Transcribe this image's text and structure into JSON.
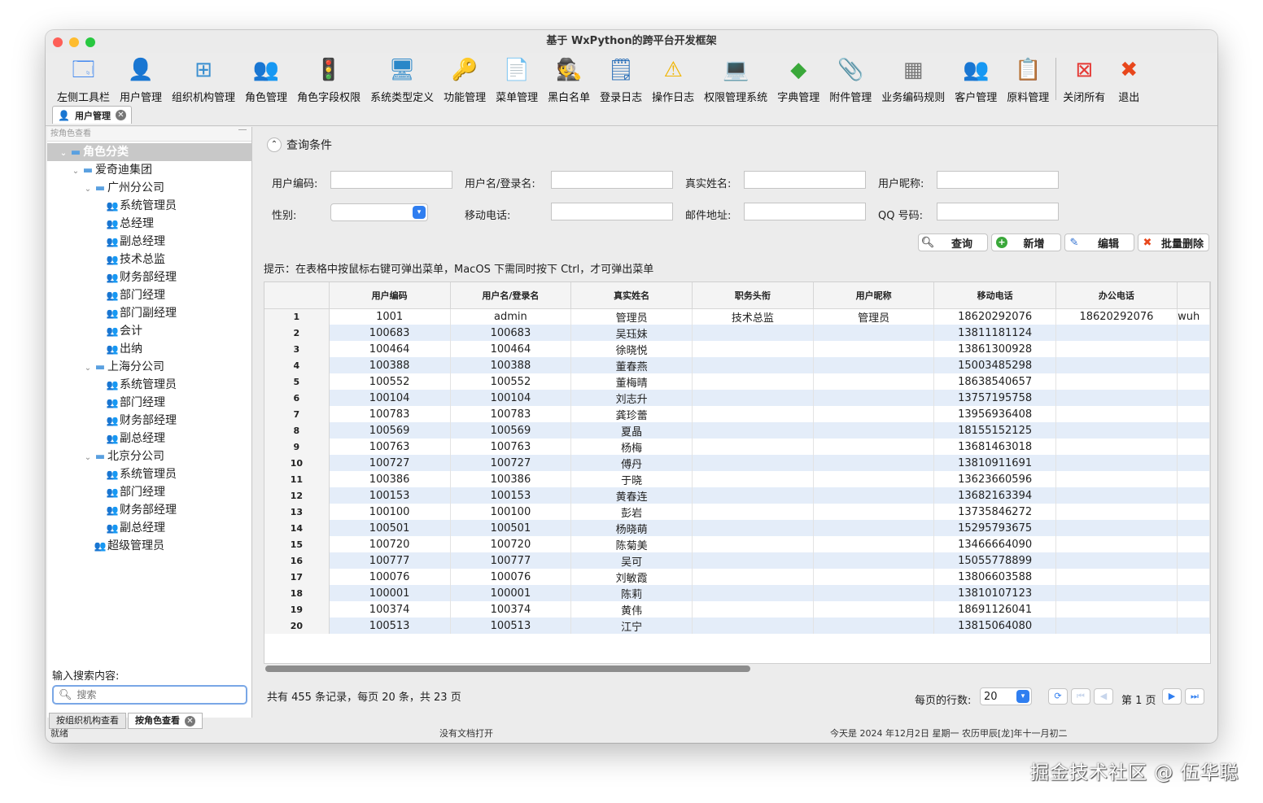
{
  "window": {
    "title": "基于 WxPython的跨平台开发框架"
  },
  "toolbar": [
    {
      "label": "左侧工具栏",
      "icon": "toolbar-window-icon",
      "glyph": "🗔",
      "color": "#2f7ef0"
    },
    {
      "label": "用户管理",
      "icon": "user-icon",
      "glyph": "👤",
      "color": "#4caf50"
    },
    {
      "label": "组织机构管理",
      "icon": "org-chart-icon",
      "glyph": "⊞",
      "color": "#3a8fd0"
    },
    {
      "label": "角色管理",
      "icon": "role-icon",
      "glyph": "👥",
      "color": "#c77d2e"
    },
    {
      "label": "角色字段权限",
      "icon": "traffic-light-icon",
      "glyph": "🚦",
      "color": "#555"
    },
    {
      "label": "系统类型定义",
      "icon": "monitor-icon",
      "glyph": "🖥",
      "color": "#2a87c8"
    },
    {
      "label": "功能管理",
      "icon": "key-icon",
      "glyph": "🔑",
      "color": "#d49a2a"
    },
    {
      "label": "菜单管理",
      "icon": "menu-doc-icon",
      "glyph": "📄",
      "color": "#777"
    },
    {
      "label": "黑白名单",
      "icon": "spy-icon",
      "glyph": "🕵",
      "color": "#222"
    },
    {
      "label": "登录日志",
      "icon": "log-window-icon",
      "glyph": "🗒",
      "color": "#2a6fb8"
    },
    {
      "label": "操作日志",
      "icon": "warning-icon",
      "glyph": "⚠",
      "color": "#f0b400"
    },
    {
      "label": "权限管理系统",
      "icon": "computers-icon",
      "glyph": "💻",
      "color": "#2a87c8"
    },
    {
      "label": "字典管理",
      "icon": "dictionary-icon",
      "glyph": "◆",
      "color": "#3aa83a"
    },
    {
      "label": "附件管理",
      "icon": "paperclip-icon",
      "glyph": "📎",
      "color": "#666"
    },
    {
      "label": "业务编码规则",
      "icon": "calculator-icon",
      "glyph": "▦",
      "color": "#777"
    },
    {
      "label": "客户管理",
      "icon": "customers-icon",
      "glyph": "👥",
      "color": "#4caf50"
    },
    {
      "label": "原料管理",
      "icon": "material-doc-icon",
      "glyph": "📋",
      "color": "#8a9a8a"
    },
    {
      "label": "关闭所有",
      "icon": "close-all-icon",
      "glyph": "⊠",
      "color": "#e53935"
    },
    {
      "label": "退出",
      "icon": "exit-icon",
      "glyph": "✖",
      "color": "#e8471c"
    }
  ],
  "doc_tab": {
    "label": "用户管理"
  },
  "left": {
    "header": "按角色查看",
    "tree": [
      {
        "label": "角色分类",
        "level": 0,
        "type": "folder",
        "expanded": true,
        "selected": true
      },
      {
        "label": "爱奇迪集团",
        "level": 1,
        "type": "folder",
        "expanded": true
      },
      {
        "label": "广州分公司",
        "level": 2,
        "type": "folder",
        "expanded": true
      },
      {
        "label": "系统管理员",
        "level": 3,
        "type": "role"
      },
      {
        "label": "总经理",
        "level": 3,
        "type": "role"
      },
      {
        "label": "副总经理",
        "level": 3,
        "type": "role"
      },
      {
        "label": "技术总监",
        "level": 3,
        "type": "role"
      },
      {
        "label": "财务部经理",
        "level": 3,
        "type": "role"
      },
      {
        "label": "部门经理",
        "level": 3,
        "type": "role"
      },
      {
        "label": "部门副经理",
        "level": 3,
        "type": "role"
      },
      {
        "label": "会计",
        "level": 3,
        "type": "role"
      },
      {
        "label": "出纳",
        "level": 3,
        "type": "role"
      },
      {
        "label": "上海分公司",
        "level": 2,
        "type": "folder",
        "expanded": true
      },
      {
        "label": "系统管理员",
        "level": 3,
        "type": "role"
      },
      {
        "label": "部门经理",
        "level": 3,
        "type": "role"
      },
      {
        "label": "财务部经理",
        "level": 3,
        "type": "role"
      },
      {
        "label": "副总经理",
        "level": 3,
        "type": "role"
      },
      {
        "label": "北京分公司",
        "level": 2,
        "type": "folder",
        "expanded": true
      },
      {
        "label": "系统管理员",
        "level": 3,
        "type": "role"
      },
      {
        "label": "部门经理",
        "level": 3,
        "type": "role"
      },
      {
        "label": "财务部经理",
        "level": 3,
        "type": "role"
      },
      {
        "label": "副总经理",
        "level": 3,
        "type": "role"
      },
      {
        "label": "超级管理员",
        "level": 2,
        "type": "role"
      }
    ],
    "search_label": "输入搜索内容:",
    "search_placeholder": "搜索",
    "bottom_tabs": [
      {
        "label": "按组织机构查看",
        "active": false
      },
      {
        "label": "按角色查看",
        "active": true
      }
    ]
  },
  "query": {
    "header": "查询条件",
    "fields": {
      "user_code": "用户编码:",
      "user_name": "用户名/登录名:",
      "real_name": "真实姓名:",
      "nickname": "用户昵称:",
      "gender": "性别:",
      "mobile": "移动电话:",
      "email": "邮件地址:",
      "qq": "QQ 号码:"
    },
    "buttons": {
      "search": "查询",
      "add": "新增",
      "edit": "编辑",
      "batch_delete": "批量删除"
    }
  },
  "hint": "提示：在表格中按鼠标右键可弹出菜单，MacOS 下需同时按下 Ctrl，才可弹出菜单",
  "grid": {
    "columns": [
      "用户编码",
      "用户名/登录名",
      "真实姓名",
      "职务头衔",
      "用户昵称",
      "移动电话",
      "办公电话",
      ""
    ],
    "rows": [
      [
        "1",
        "1001",
        "admin",
        "管理员",
        "技术总监",
        "管理员",
        "18620292076",
        "18620292076",
        "wuh"
      ],
      [
        "2",
        "100683",
        "100683",
        "吴珏妹",
        "",
        "",
        "13811181124",
        "",
        ""
      ],
      [
        "3",
        "100464",
        "100464",
        "徐晓悦",
        "",
        "",
        "13861300928",
        "",
        ""
      ],
      [
        "4",
        "100388",
        "100388",
        "董春燕",
        "",
        "",
        "15003485298",
        "",
        ""
      ],
      [
        "5",
        "100552",
        "100552",
        "董梅晴",
        "",
        "",
        "18638540657",
        "",
        ""
      ],
      [
        "6",
        "100104",
        "100104",
        "刘志升",
        "",
        "",
        "13757195758",
        "",
        ""
      ],
      [
        "7",
        "100783",
        "100783",
        "龚珍蕾",
        "",
        "",
        "13956936408",
        "",
        ""
      ],
      [
        "8",
        "100569",
        "100569",
        "夏晶",
        "",
        "",
        "18155152125",
        "",
        ""
      ],
      [
        "9",
        "100763",
        "100763",
        "杨梅",
        "",
        "",
        "13681463018",
        "",
        ""
      ],
      [
        "10",
        "100727",
        "100727",
        "傅丹",
        "",
        "",
        "13810911691",
        "",
        ""
      ],
      [
        "11",
        "100386",
        "100386",
        "于晓",
        "",
        "",
        "13623660596",
        "",
        ""
      ],
      [
        "12",
        "100153",
        "100153",
        "黄春连",
        "",
        "",
        "13682163394",
        "",
        ""
      ],
      [
        "13",
        "100100",
        "100100",
        "彭岩",
        "",
        "",
        "13735846272",
        "",
        ""
      ],
      [
        "14",
        "100501",
        "100501",
        "杨晓萌",
        "",
        "",
        "15295793675",
        "",
        ""
      ],
      [
        "15",
        "100720",
        "100720",
        "陈菊美",
        "",
        "",
        "13466664090",
        "",
        ""
      ],
      [
        "16",
        "100777",
        "100777",
        "吴可",
        "",
        "",
        "15055778899",
        "",
        ""
      ],
      [
        "17",
        "100076",
        "100076",
        "刘敏霞",
        "",
        "",
        "13806603588",
        "",
        ""
      ],
      [
        "18",
        "100001",
        "100001",
        "陈莉",
        "",
        "",
        "13810107123",
        "",
        ""
      ],
      [
        "19",
        "100374",
        "100374",
        "黄伟",
        "",
        "",
        "18691126041",
        "",
        ""
      ],
      [
        "20",
        "100513",
        "100513",
        "江宁",
        "",
        "",
        "13815064080",
        "",
        ""
      ]
    ]
  },
  "footer": {
    "stats": "共有 455 条记录，每页 20 条，共 23 页",
    "per_page_label": "每页的行数:",
    "per_page_value": "20",
    "page_text": "第 1 页"
  },
  "status": {
    "left": "就绪",
    "center": "没有文档打开",
    "right": "今天是 2024 年12月2日 星期一 农历甲辰[龙]年十一月初二"
  },
  "watermark": "掘金技术社区 @ 伍华聪"
}
